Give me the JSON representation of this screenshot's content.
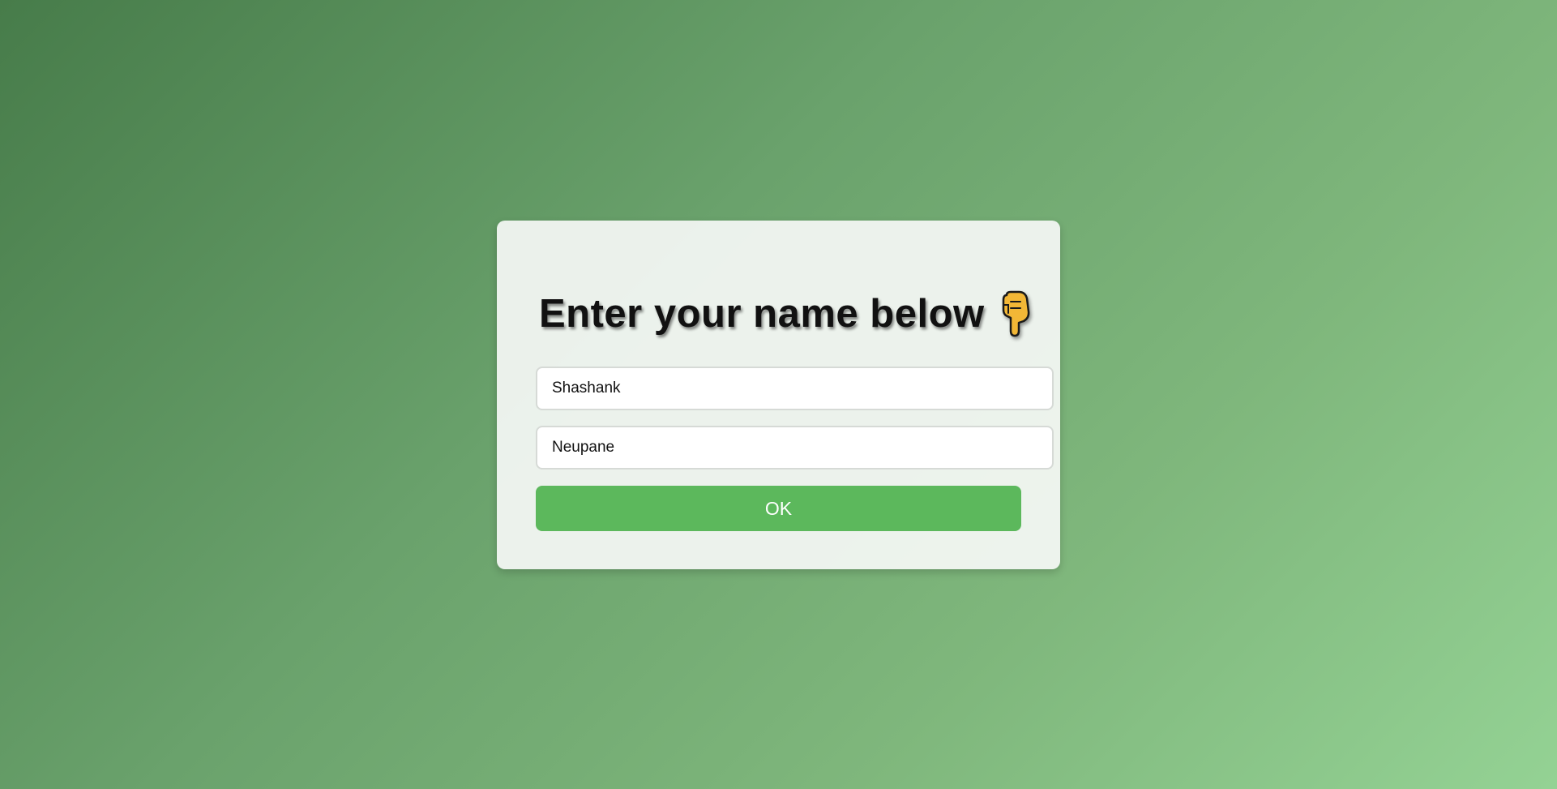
{
  "form": {
    "title": "Enter your name below",
    "title_icon": "pointing-down-hand-icon",
    "first_name_value": "Shashank",
    "last_name_value": "Neupane",
    "submit_label": "OK"
  },
  "colors": {
    "accent": "#5cb85c",
    "background_start": "#477c4a",
    "background_end": "#94d294",
    "card": "#f2f6f2"
  }
}
